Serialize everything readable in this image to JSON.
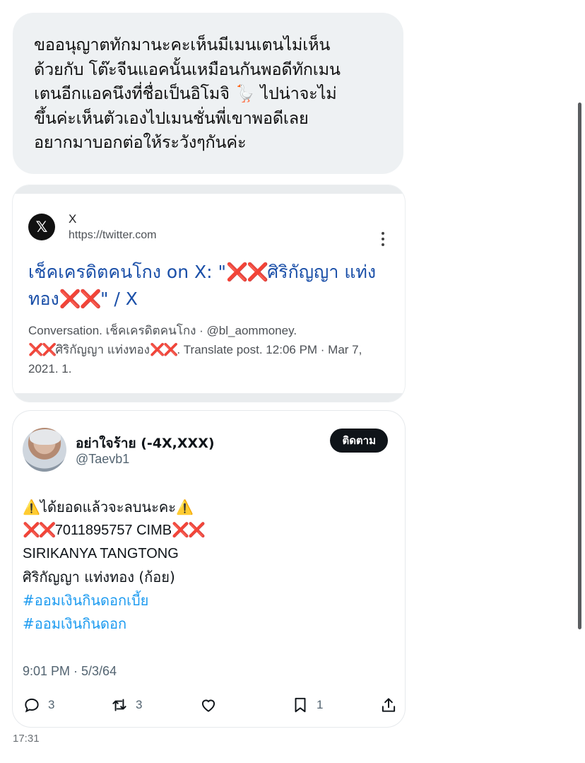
{
  "message": {
    "text": "ขออนุญาตทักมานะคะเห็นมีเมนเตนไม่เห็น\nด้วยกับ โต๊ะจีนแอคนั้นเหมือนกันพอดีทักเมน\nเตนอีกแอคนึงที่ชื่อเป็นอิโมจิ 🪿 ไปน่าจะไม่\nขึ้นค่ะเห็นตัวเองไปเมนชั่นพี่เขาพอดีเลย\nอยากมาบอกต่อให้ระวังๆกันค่ะ",
    "sent_time": "17:31"
  },
  "link_preview": {
    "site_name": "X",
    "site_url": "https://twitter.com",
    "title_pre": "เช็คเครดิตคนโกง on X: \"",
    "title_x1": "❌❌",
    "title_mid": "ศิริกัญญา แท่งทอง",
    "title_x2": "❌❌",
    "title_post": "\" / X",
    "snippet_1": "Conversation. เช็คเครดิตคนโกง · @bl_aommoney.",
    "snippet_x1": "❌❌",
    "snippet_2": "ศิริกัญญา แท่งทอง",
    "snippet_x2": "❌❌",
    "snippet_3": ". Translate post. 12:06 PM · Mar 7, 2021. 1.",
    "icon": "x-logo-icon"
  },
  "tweet": {
    "display_name": "อย่าใจร้าย (-4X,XXX)",
    "handle": "@Taevb1",
    "follow_label": "ติดตาม",
    "warn_icon": "⚠️",
    "line1": "ได้ยอดแล้วจะลบนะคะ",
    "line2_x1": "❌❌",
    "line2": "7011895757 CIMB",
    "line2_x2": "❌❌",
    "line3": "SIRIKANYA TANGTONG",
    "line4": "ศิริกัญญา แท่งทอง (ก้อย)",
    "hashtag1": "#ออมเงินกินดอกเบี้ย",
    "hashtag2": "#ออมเงินกินดอก",
    "timestamp": "9:01 PM · 5/3/64",
    "replies": "3",
    "retweets": "3",
    "bookmarks": "1"
  },
  "colors": {
    "bubble_bg": "#eef1f3",
    "link_blue": "#1a4fa8",
    "hashtag_blue": "#1d9bf0",
    "cross_red": "#d8232a"
  }
}
